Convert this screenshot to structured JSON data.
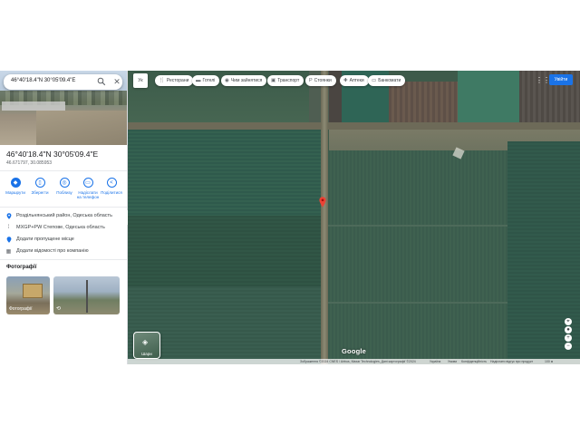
{
  "search": {
    "query": "46°40'18.4\"N 30°05'09.4\"E"
  },
  "place": {
    "title": "46°40'18.4\"N 30°05'09.4\"E",
    "decimal": "46.671797, 30.085953"
  },
  "actions": [
    {
      "label": "Маршрути",
      "icon": "directions-icon"
    },
    {
      "label": "Зберегти",
      "icon": "bookmark-icon"
    },
    {
      "label": "Поблизу",
      "icon": "nearby-icon"
    },
    {
      "label": "Надіслати на телефон",
      "icon": "send-to-phone-icon"
    },
    {
      "label": "Поділитися",
      "icon": "share-icon"
    }
  ],
  "info": [
    {
      "text": "Роздільнянський район, Одеська область",
      "icon": "location-icon"
    },
    {
      "text": "MXGP+PW Степове, Одеська область",
      "icon": "plus-code-icon"
    },
    {
      "text": "Додати пропущене місце",
      "icon": "add-place-icon"
    },
    {
      "text": "Додати відомості про компанію",
      "icon": "business-icon"
    }
  ],
  "photos": {
    "title": "Фотографії",
    "caption": "Фотографії"
  },
  "map": {
    "language_button": "Ук",
    "chips": [
      {
        "label": "Ресторани",
        "icon": "restaurant-icon"
      },
      {
        "label": "Готелі",
        "icon": "hotel-icon"
      },
      {
        "label": "Чим зайнятися",
        "icon": "attractions-icon"
      },
      {
        "label": "Транспорт",
        "icon": "transit-icon"
      },
      {
        "label": "Стоянки",
        "icon": "parking-icon"
      },
      {
        "label": "Аптеки",
        "icon": "pharmacy-icon"
      },
      {
        "label": "Банкомати",
        "icon": "atm-icon"
      }
    ],
    "signin": "Увійти",
    "layers_label": "Шари",
    "google": "Google",
    "footer": {
      "imagery": "Зображення ©2024 CNES / Airbus, Maxar Technologies, Дані картографії ©2024",
      "country": "Україна",
      "terms": "Умови",
      "privacy": "Конфіденційність",
      "feedback": "Надіслати відгук про продукт",
      "scale": "100 м"
    }
  },
  "colors": {
    "accent": "#1a73e8",
    "pin": "#ea4335"
  }
}
